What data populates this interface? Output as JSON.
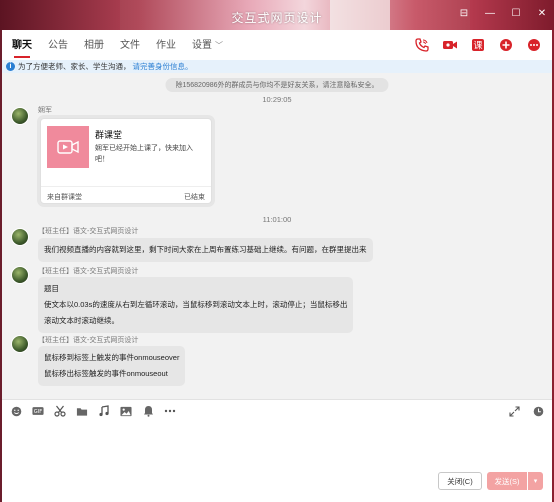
{
  "window": {
    "title": "交互式网页设计",
    "controls": [
      "pin-icon",
      "minimize-icon",
      "maximize-icon",
      "close-icon"
    ]
  },
  "tabs": [
    {
      "label": "聊天",
      "active": true
    },
    {
      "label": "公告"
    },
    {
      "label": "相册"
    },
    {
      "label": "文件"
    },
    {
      "label": "作业"
    },
    {
      "label": "设置"
    }
  ],
  "header_icons": [
    "phone-icon",
    "video-call-icon",
    "class-icon",
    "add-icon",
    "more-icon"
  ],
  "notice": {
    "text": "为了方便老师、家长、学生沟通，",
    "link": "请完善身份信息。"
  },
  "chat": {
    "privacy_notice": "除156820986外的群成员与你均不是好友关系，请注意隐私安全。",
    "time1": "10:29:05",
    "time2": "11:01:00",
    "msg1": {
      "sender": "娴军",
      "card_title": "群课堂",
      "card_desc": "娴军已经开始上课了，快来加入吧！",
      "card_from": "来自群课堂",
      "card_status": "已结束"
    },
    "msg2": {
      "sender": "【班主任】语文-交互式网页设计",
      "text": "我们视频直播的内容就到这里，剩下时间大家在上周布置练习基础上继续。有问题，在群里提出来"
    },
    "msg3": {
      "sender": "【班主任】语文-交互式网页设计",
      "lines": [
        "题目",
        "使文本以0.03s的速度从右到左循环滚动，当鼠标移到滚动文本上时，滚动停止；当鼠标移出",
        "滚动文本时滚动继续。"
      ]
    },
    "msg4": {
      "sender": "【班主任】语文-交互式网页设计",
      "lines": [
        "鼠标移到标签上触发的事件onmouseover",
        "鼠标移出标签触发的事件onmouseout"
      ]
    }
  },
  "toolbar": [
    "emoji-icon",
    "gif-icon",
    "scissors-icon",
    "folder-icon",
    "music-icon",
    "image-icon",
    "bell-icon",
    "more-icon"
  ],
  "toolbar_right": [
    "expand-icon",
    "history-icon"
  ],
  "buttons": {
    "close": "关闭(C)",
    "send": "发送(S)"
  },
  "colors": {
    "accent": "#d8232a",
    "send_disabled": "#f3a3a3",
    "notice_bg": "#e6f1fb",
    "link": "#2b7fd3"
  }
}
